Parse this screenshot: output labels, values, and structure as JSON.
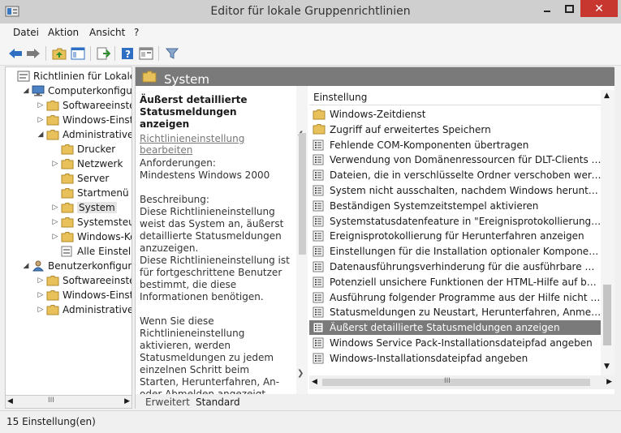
{
  "window": {
    "title": "Editor für lokale Gruppenrichtlinien",
    "close_glyph": "✕"
  },
  "menu": [
    "Datei",
    "Aktion",
    "Ansicht",
    "?"
  ],
  "tree": [
    {
      "label": "Richtlinien für Lokaler Co",
      "arrow": "",
      "icon": "policy-icon"
    },
    {
      "label": "Computerkonfigurati",
      "arrow": "◢",
      "icon": "computer-icon"
    },
    {
      "label": "Softwareeinstellu",
      "arrow": "▷",
      "icon": "folder-icon"
    },
    {
      "label": "Windows-Einstell",
      "arrow": "▷",
      "icon": "folder-icon"
    },
    {
      "label": "Administrative Vo",
      "arrow": "◢",
      "icon": "folder-icon"
    },
    {
      "label": "Drucker",
      "arrow": "",
      "icon": "folder-icon"
    },
    {
      "label": "Netzwerk",
      "arrow": "▷",
      "icon": "folder-icon"
    },
    {
      "label": "Server",
      "arrow": "",
      "icon": "folder-icon"
    },
    {
      "label": "Startmenü un",
      "arrow": "",
      "icon": "folder-icon"
    },
    {
      "label": "System",
      "arrow": "▷",
      "icon": "folder-icon",
      "selected": true
    },
    {
      "label": "Systemsteuer",
      "arrow": "▷",
      "icon": "folder-icon"
    },
    {
      "label": "Windows-Kor",
      "arrow": "▷",
      "icon": "folder-icon"
    },
    {
      "label": "Alle Einstellur",
      "arrow": "",
      "icon": "settings-page-icon"
    },
    {
      "label": "Benutzerkonfigurati",
      "arrow": "◢",
      "icon": "user-icon"
    },
    {
      "label": "Softwareeinstellu",
      "arrow": "▷",
      "icon": "folder-icon"
    },
    {
      "label": "Windows-Einstell",
      "arrow": "▷",
      "icon": "folder-icon"
    },
    {
      "label": "Administrative Vo",
      "arrow": "▷",
      "icon": "folder-icon"
    }
  ],
  "scroll_glyph": "III",
  "header": {
    "title": "System"
  },
  "description": {
    "title": "Äußerst detaillierte Statusmeldungen anzeigen",
    "link": "Richtlinieneinstellung bearbeiten",
    "requirements_label": "Anforderungen:",
    "requirements_value": "Mindestens Windows 2000",
    "description_label": "Beschreibung:",
    "description_p1": "Diese Richtlinieneinstellung weist das System an, äußerst detaillierte Statusmeldungen anzuzeigen.",
    "description_p2": "Diese Richtlinieneinstellung ist für fortgeschrittene Benutzer bestimmt, die diese Informationen benötigen.",
    "description_p3": "Wenn Sie diese Richtlinieneinstellung aktivieren, werden Statusmeldungen zu jedem einzelnen Schritt beim Starten, Herunterfahren, An- oder Abmelden angezeigt."
  },
  "tabs": [
    "Erweitert",
    "Standard"
  ],
  "list": {
    "column_header": "Einstellung",
    "items": [
      {
        "text": "Windows-Zeitdienst",
        "icon": "folder-icon"
      },
      {
        "text": "Zugriff auf erweitertes Speichern",
        "icon": "folder-icon"
      },
      {
        "text": "Fehlende COM-Komponenten übertragen",
        "icon": "setting-icon"
      },
      {
        "text": "Verwendung von Domänenressourcen für DLT-Clients (Distr...",
        "icon": "setting-icon"
      },
      {
        "text": "Dateien, die in verschlüsselte Ordner verschoben werden, ni...",
        "icon": "setting-icon"
      },
      {
        "text": "System nicht ausschalten, nachdem Windows heruntergefa...",
        "icon": "setting-icon"
      },
      {
        "text": "Beständigen Systemzeitstempel aktivieren",
        "icon": "setting-icon"
      },
      {
        "text": "Systemstatusdatenfeature in \"Ereignisprotokollierung für He...",
        "icon": "setting-icon"
      },
      {
        "text": "Ereignisprotokollierung für Herunterfahren anzeigen",
        "icon": "setting-icon"
      },
      {
        "text": "Einstellungen für die Installation optionaler Komponenten u...",
        "icon": "setting-icon"
      },
      {
        "text": "Datenausführungsverhinderung für die ausführbare HTML-...",
        "icon": "setting-icon"
      },
      {
        "text": "Potenziell unsichere Funktionen der HTML-Hilfe auf bestim...",
        "icon": "setting-icon"
      },
      {
        "text": "Ausführung folgender Programme aus der Hilfe nicht zulass...",
        "icon": "setting-icon"
      },
      {
        "text": "Statusmeldungen zu Neustart, Herunterfahren, Anmeldung ...",
        "icon": "setting-icon"
      },
      {
        "text": "Äußerst detaillierte Statusmeldungen anzeigen",
        "icon": "setting-icon",
        "selected": true
      },
      {
        "text": "Windows Service Pack-Installationsdateipfad angeben",
        "icon": "setting-icon"
      },
      {
        "text": "Windows-Installationsdateipfad angeben",
        "icon": "setting-icon"
      }
    ]
  },
  "status": {
    "text": "15 Einstellung(en)"
  }
}
